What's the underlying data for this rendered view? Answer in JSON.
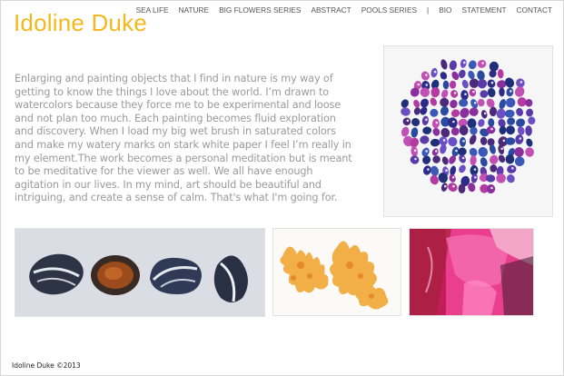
{
  "site": {
    "title": "Idoline Duke"
  },
  "nav": [
    "SEA LIFE",
    "NATURE",
    "BIG FLOWERS SERIES",
    "ABSTRACT",
    "POOLS SERIES",
    "|",
    "BIO",
    "STATEMENT",
    "CONTACT"
  ],
  "intro": "Enlarging and painting objects that I find in nature is my way of getting to know the things I love about the world. I’m drawn to watercolors because they force me to be experimental and loose and not plan too much. Each painting becomes fluid exploration and discovery. When I load my big wet brush in saturated colors and make my watery marks on stark white paper I feel I’m really in my element.The work becomes a personal meditation but is meant to be meditative for the viewer as well. We all have enough agitation in our lives. In my mind, art should be beautiful and intriguing, and create a sense of calm. That's what I'm going for.",
  "footer": "Idoline Duke ©2013",
  "colors": {
    "title": "#f4b81c",
    "nav": "#555555",
    "body_text": "#9a9a9a"
  }
}
